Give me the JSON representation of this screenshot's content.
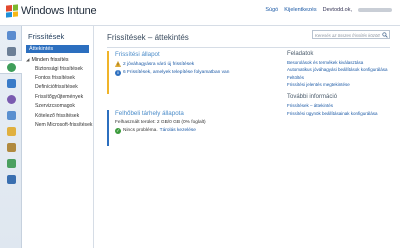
{
  "header": {
    "logo_text": "Windows Intune",
    "links": [
      "Súgó",
      "Kijelentkezés"
    ],
    "user_label": "Devtodd.ok,"
  },
  "rail": {
    "icons": [
      {
        "name": "overview-icon",
        "color": "#5b8ccf"
      },
      {
        "name": "computers-icon",
        "color": "#6c7f96"
      },
      {
        "name": "updates-icon",
        "color": "#3f9e5a",
        "active": true
      },
      {
        "name": "protection-icon",
        "color": "#3a7bc8"
      },
      {
        "name": "alerts-icon",
        "color": "#7a5bb0"
      },
      {
        "name": "software-icon",
        "color": "#5a90d0"
      },
      {
        "name": "licenses-icon",
        "color": "#e0b040"
      },
      {
        "name": "policy-icon",
        "color": "#b08a40"
      },
      {
        "name": "reports-icon",
        "color": "#4aa060"
      },
      {
        "name": "admin-icon",
        "color": "#3a6fb0"
      }
    ]
  },
  "sidebar": {
    "title": "Frissítések",
    "selected": "Áttekintés",
    "group": "Minden frissítés",
    "items": [
      "Biztonsági frissítések",
      "Fontos frissítések",
      "Definíciófrissítések",
      "Frissítőgyűjtemények",
      "Szervizcsomagok",
      "Kötelező frissítések",
      "Nem Microsoft-frissítések"
    ]
  },
  "main": {
    "title": "Frissítések – áttekintés",
    "search_placeholder": "Keresés az összes frissítés között",
    "status_panel": {
      "title": "Frissítési állapot",
      "lines": [
        {
          "icon": "warning-icon",
          "text": "2 jóváhagyásra váró új frissítések"
        },
        {
          "icon": "info-icon",
          "text": "6 Frissítések, amelyek telepítése folyamatban van"
        }
      ]
    },
    "storage_panel": {
      "title": "Felhőbeli tárhely állapota",
      "usage": "Felhasznált terület: 2 GB/0 GB (0% foglalt)",
      "ok_text": "Nincs probléma.",
      "ok_link": "Tárolás kezelése"
    },
    "tasks": {
      "title": "Feladatok",
      "links": [
        "Besorolások és termékek kiválasztása",
        "Automatikus jóváhagyási beállítások konfigurálása",
        "Feltöltés",
        "Frissítési jelentés megtekintése"
      ]
    },
    "more_info": {
      "title": "További információ",
      "links": [
        "Frissítések – áttekintés",
        "Frissítési ügynök beállításainak konfigurálása"
      ]
    }
  }
}
